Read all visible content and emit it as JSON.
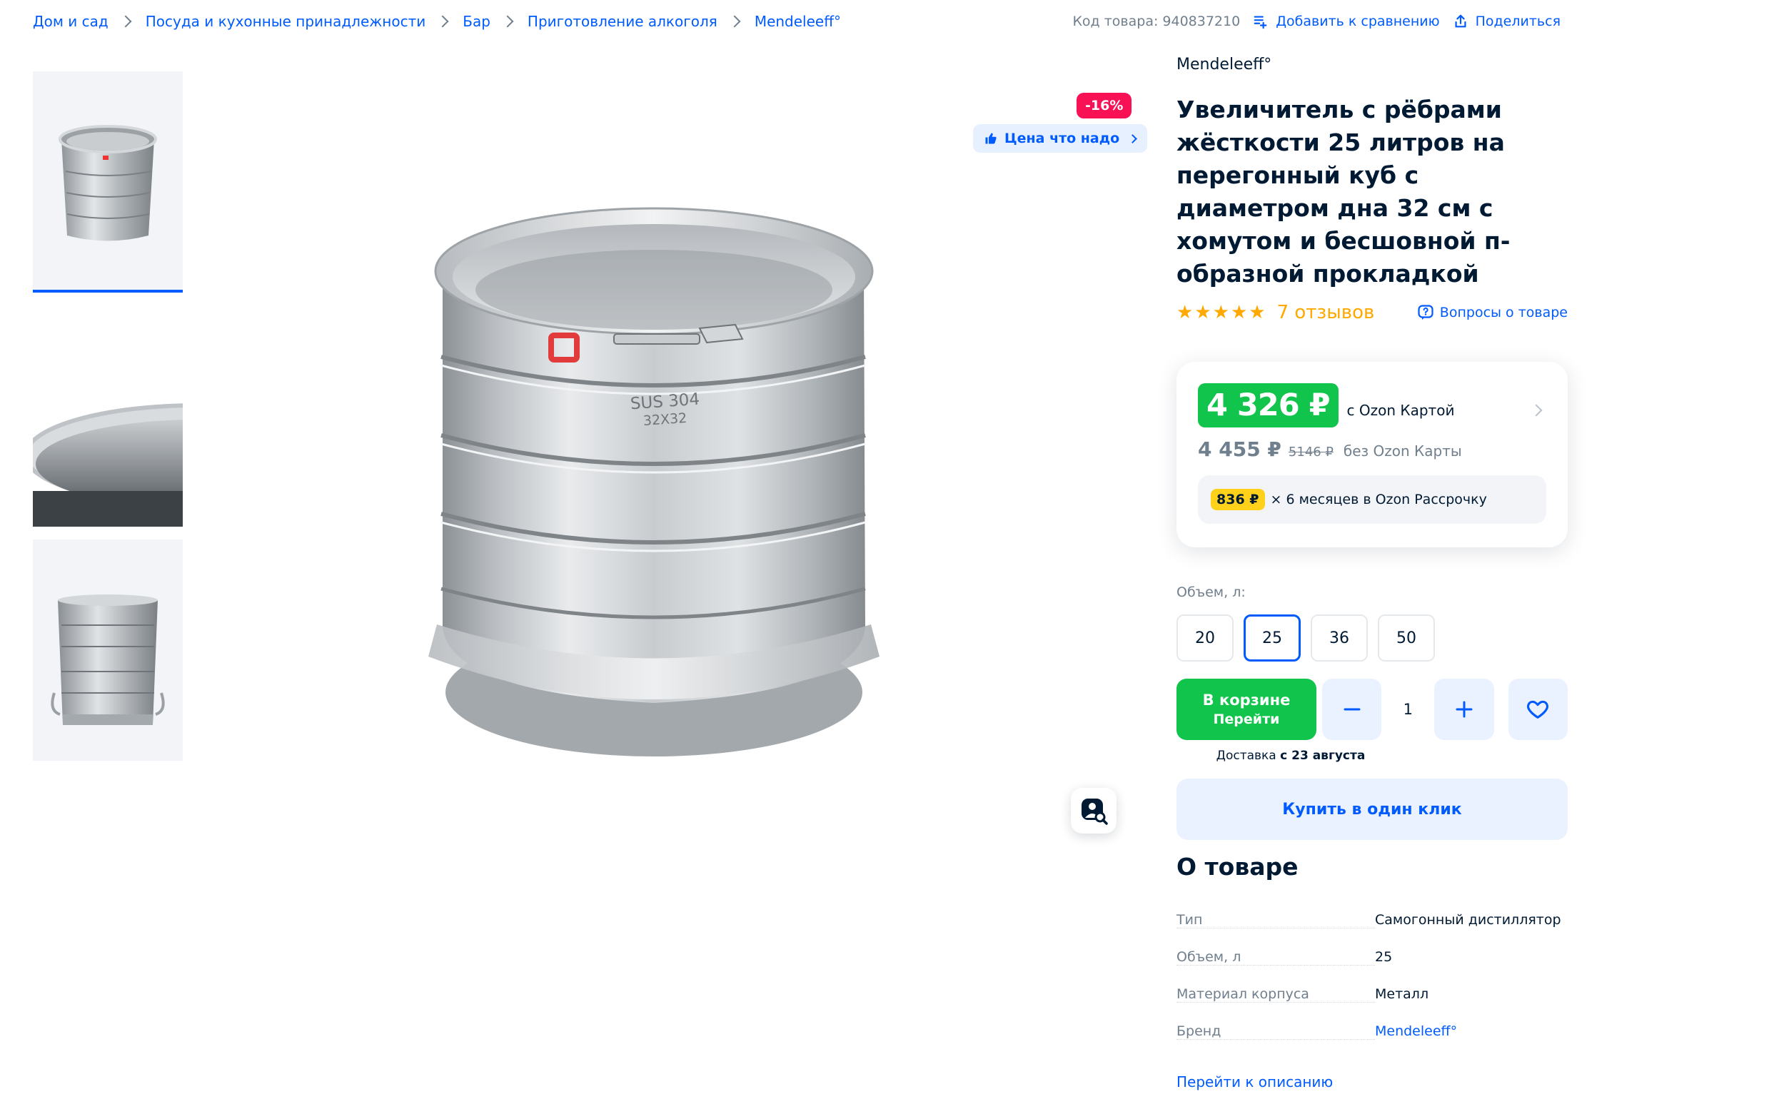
{
  "breadcrumbs": [
    "Дом и сад",
    "Посуда и кухонные принадлежности",
    "Бар",
    "Приготовление алкоголя",
    "Mendeleeff°"
  ],
  "topbar": {
    "sku": "Код товара: 940837210",
    "compare": "Добавить к сравнению",
    "share": "Поделиться"
  },
  "gallery": {
    "discount_badge": "-16%",
    "price_chip": "Цена что надо",
    "engraving_line1": "SUS 304",
    "engraving_line2": "32X32"
  },
  "product": {
    "brand": "Mendeleeff°",
    "title": "Увеличитель с рёбрами жёсткости 25 литров на перегонный куб с диаметром дна 32 см с хомутом и бесшовной п-образной прокладкой",
    "reviews": "7 отзывов",
    "questions": "Вопросы о товаре",
    "stars": 5
  },
  "price": {
    "card_price": "4 326 ₽",
    "card_note": "с Ozon Картой",
    "regular_price": "4 455 ₽",
    "old_price": "5146 ₽",
    "regular_note": "без Ozon Карты",
    "installment_amount": "836 ₽",
    "installment_text": "× 6 месяцев в Ozon Рассрочку"
  },
  "volume": {
    "label": "Объем, л:",
    "options": [
      "20",
      "25",
      "36",
      "50"
    ],
    "selected": "25"
  },
  "buy": {
    "cart_line1": "В корзине",
    "cart_line2": "Перейти",
    "quantity": "1",
    "delivery_prefix": "Доставка ",
    "delivery_date": "с 23 августа",
    "one_click": "Купить в один клик"
  },
  "about": {
    "title": "О товаре",
    "specs": [
      {
        "key": "Тип",
        "value": "Самогонный дистиллятор"
      },
      {
        "key": "Объем, л",
        "value": "25"
      },
      {
        "key": "Материал корпуса",
        "value": "Металл"
      },
      {
        "key": "Бренд",
        "value": "Mendeleeff°"
      }
    ],
    "goto_description": "Перейти к описанию"
  },
  "colors": {
    "accent": "#005bff",
    "green": "#10c44c",
    "discount": "#f91155",
    "installment": "#ffd11a",
    "star": "#ffa800"
  },
  "icons": [
    "chevron-right-icon",
    "compare-icon",
    "share-icon",
    "thumbs-up-icon",
    "question-icon",
    "star-icon",
    "minus-icon",
    "plus-icon",
    "heart-icon",
    "image-search-icon"
  ]
}
